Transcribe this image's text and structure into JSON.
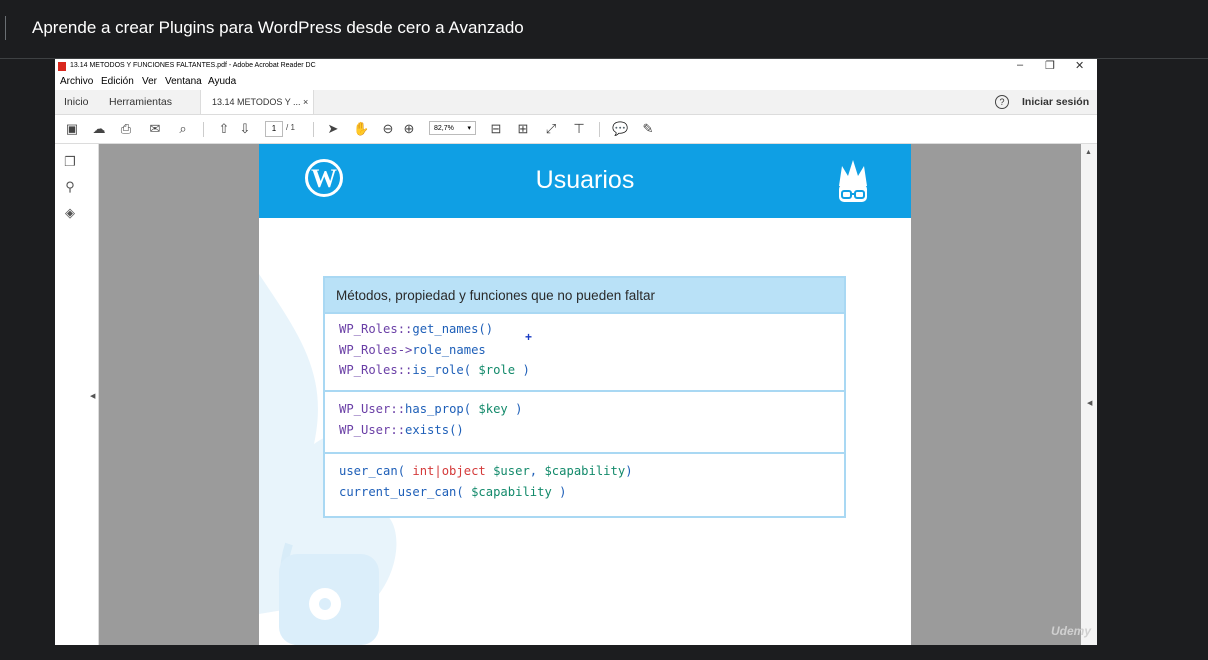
{
  "course": {
    "title": "Aprende a crear Plugins para WordPress desde cero a Avanzado"
  },
  "window": {
    "title": "13.14 METODOS Y FUNCIONES FALTANTES.pdf - Adobe Acrobat Reader DC"
  },
  "menu": [
    "Archivo",
    "Edición",
    "Ver",
    "Ventana",
    "Ayuda"
  ],
  "tabs": {
    "home": "Inicio",
    "tools": "Herramientas",
    "doc": "13.14 METODOS Y ... ×",
    "signin": "Iniciar sesión",
    "help_glyph": "?"
  },
  "toolbar": {
    "page_current": "1",
    "page_total": "/ 1",
    "zoom": "82,7%"
  },
  "slide": {
    "title": "Usuarios",
    "card_title": "Métodos, propiedad y funciones que no pueden faltar",
    "line1a": "WP_Roles::",
    "line1b": "get_names()",
    "line2a": "WP_Roles->",
    "line2b": "role_names",
    "line3a": "WP_Roles::",
    "line3b": "is_role( ",
    "line3c": "$role",
    "line3d": " )",
    "line4a": "WP_User::",
    "line4b": "has_prop( ",
    "line4c": "$key",
    "line4d": " )",
    "line5a": "WP_User::",
    "line5b": "exists()",
    "line6a": "user_can( ",
    "line6b": "int|object ",
    "line6c": "$user",
    "line6d": ", ",
    "line6e": "$capability",
    "line6f": ")",
    "line7a": "current_user_can( ",
    "line7b": "$capability",
    "line7c": " )"
  },
  "watermark": "Udemy",
  "colors": {
    "header_blue": "#0f9fe4",
    "card_head": "#b9e1f7",
    "page_bg": "#1c1d1f"
  }
}
